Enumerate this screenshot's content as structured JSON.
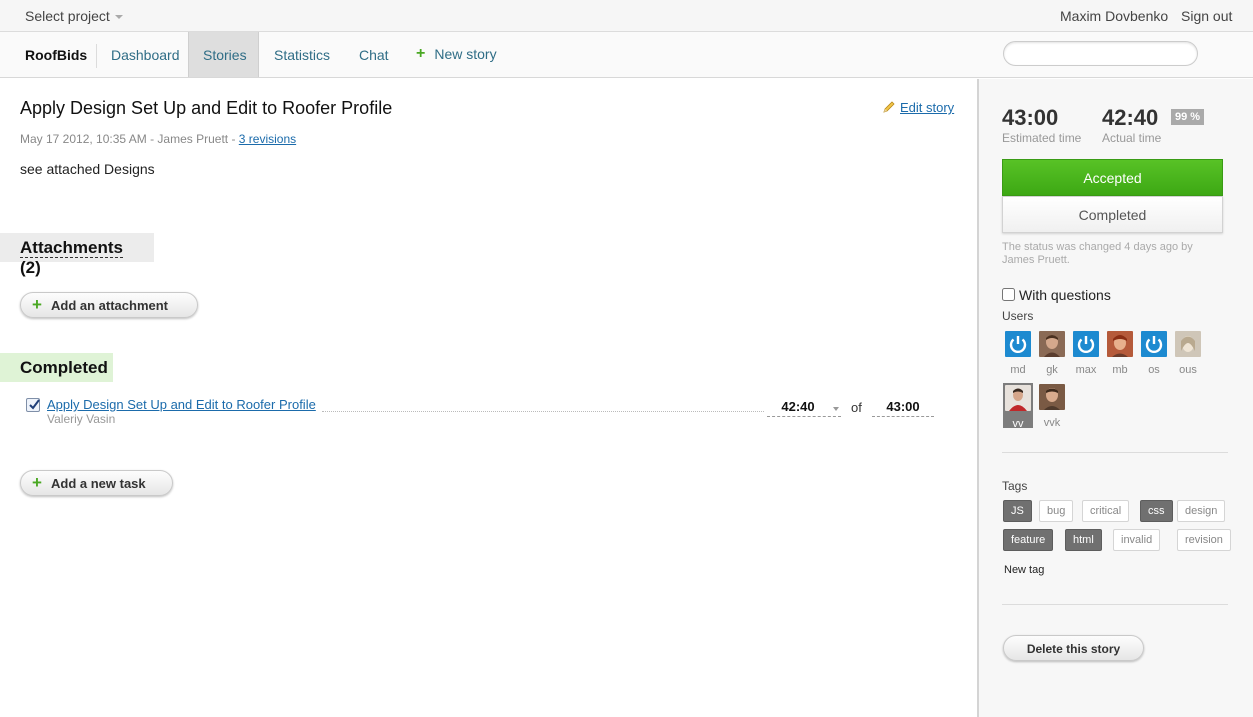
{
  "topbar": {
    "project_select": "Select project",
    "user_name": "Maxim Dovbenko",
    "sign_out": "Sign out"
  },
  "nav": {
    "brand": "RoofBids",
    "items": [
      "Dashboard",
      "Stories",
      "Statistics",
      "Chat"
    ],
    "active": "Stories",
    "new_story": "New story",
    "search_placeholder": ""
  },
  "story": {
    "title": "Apply Design Set Up and Edit to Roofer Profile",
    "edit": "Edit story",
    "meta_prefix": "May 17 2012, 10:35 AM - James Pruett - ",
    "revisions": "3 revisions",
    "description": "see attached Designs"
  },
  "attachments": {
    "title": "Attachments",
    "count": "(2)",
    "add_button": "Add an attachment"
  },
  "completed": {
    "title": "Completed",
    "tasks": [
      {
        "title": "Apply Design Set Up and Edit to Roofer Profile",
        "assignee": "Valeriy Vasin",
        "actual": "42:40",
        "of": "of",
        "estimated": "43:00",
        "checked": true
      }
    ],
    "add_task": "Add a new task"
  },
  "sidebar": {
    "estimated_value": "43:00",
    "estimated_label": "Estimated time",
    "actual_value": "42:40",
    "actual_label": "Actual time",
    "percent": "99 %",
    "status_accepted": "Accepted",
    "status_completed": "Completed",
    "status_note": "The status was changed 4 days ago by James Pruett.",
    "questions_label": "With questions",
    "users_label": "Users",
    "users": [
      {
        "name": "md",
        "avatar": "power-icon"
      },
      {
        "name": "gk",
        "avatar": "photo"
      },
      {
        "name": "max",
        "avatar": "power-icon"
      },
      {
        "name": "mb",
        "avatar": "photo"
      },
      {
        "name": "os",
        "avatar": "power-icon"
      },
      {
        "name": "ous",
        "avatar": "photo"
      },
      {
        "name": "vv",
        "avatar": "photo",
        "selected": true
      },
      {
        "name": "vvk",
        "avatar": "photo"
      }
    ],
    "tags_label": "Tags",
    "tags": [
      {
        "name": "JS",
        "on": true
      },
      {
        "name": "bug",
        "on": false
      },
      {
        "name": "critical",
        "on": false
      },
      {
        "name": "css",
        "on": true
      },
      {
        "name": "design",
        "on": false
      },
      {
        "name": "feature",
        "on": true
      },
      {
        "name": "html",
        "on": true
      },
      {
        "name": "invalid",
        "on": false
      },
      {
        "name": "revision",
        "on": false
      }
    ],
    "new_tag": "New tag",
    "delete_button": "Delete this story"
  },
  "colors": {
    "accent_link": "#1b6bab",
    "accepted_green": "#4ab61d",
    "plus_green": "#4aa823",
    "avatar_blue": "#1d8ad0"
  }
}
